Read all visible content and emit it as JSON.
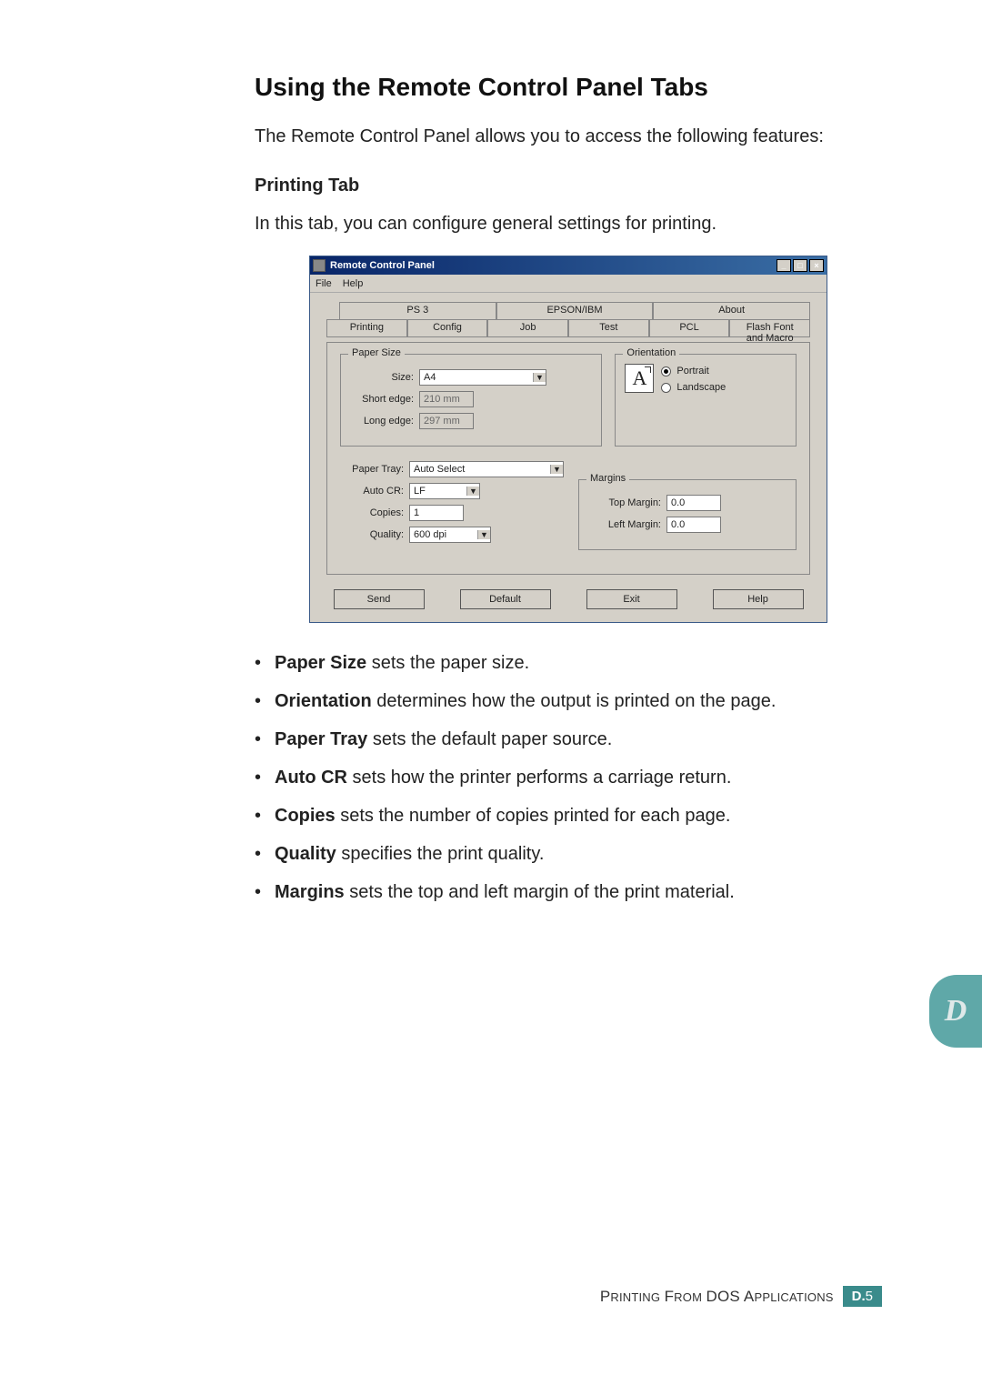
{
  "heading": "Using the Remote Control Panel Tabs",
  "intro": "The Remote Control Panel allows you to access the following features:",
  "subheading": "Printing Tab",
  "subintro": "In this tab, you can configure general settings for printing.",
  "window": {
    "title": "Remote Control Panel",
    "menu": {
      "file": "File",
      "help": "Help"
    },
    "win_btns": {
      "min": "_",
      "restore": "□",
      "close": "×"
    },
    "tabs_back": {
      "ps3": "PS 3",
      "epson": "EPSON/IBM",
      "about": "About"
    },
    "tabs_front": {
      "printing": "Printing",
      "config": "Config",
      "job": "Job",
      "test": "Test",
      "pcl": "PCL",
      "flash": "Flash Font and Macro"
    },
    "paper_group": {
      "legend": "Paper Size",
      "size_label": "Size:",
      "size_value": "A4",
      "short_edge_label": "Short edge:",
      "short_edge_value": "210 mm",
      "long_edge_label": "Long edge:",
      "long_edge_value": "297 mm"
    },
    "orient_group": {
      "legend": "Orientation",
      "icon_glyph": "A",
      "portrait": "Portrait",
      "landscape": "Landscape"
    },
    "mid": {
      "paper_tray_label": "Paper Tray:",
      "paper_tray_value": "Auto Select",
      "auto_cr_label": "Auto CR:",
      "auto_cr_value": "LF",
      "copies_label": "Copies:",
      "copies_value": "1",
      "quality_label": "Quality:",
      "quality_value": "600 dpi"
    },
    "margins_group": {
      "legend": "Margins",
      "top_label": "Top Margin:",
      "top_value": "0.0",
      "left_label": "Left Margin:",
      "left_value": "0.0"
    },
    "buttons": {
      "send": "Send",
      "default": "Default",
      "exit": "Exit",
      "help": "Help"
    }
  },
  "bullets": [
    {
      "term": "Paper Size",
      "rest": " sets the paper size."
    },
    {
      "term": "Orientation",
      "rest": " determines how the output is printed on the page."
    },
    {
      "term": "Paper Tray",
      "rest": " sets the default paper source."
    },
    {
      "term": "Auto CR",
      "rest": " sets how the printer performs a carriage return."
    },
    {
      "term": "Copies",
      "rest": " sets the number of copies printed for each page."
    },
    {
      "term": "Quality",
      "rest": " specifies the print quality."
    },
    {
      "term": "Margins",
      "rest": " sets the top and left margin of the print material."
    }
  ],
  "side_tab": "D",
  "footer": {
    "text_small1": "P",
    "text_rest1": "RINTING",
    "text_small2": "F",
    "text_rest2": "ROM",
    "text_small3": "DOS A",
    "text_rest3": "PPLICATIONS",
    "page_prefix": "D.",
    "page_num": "5"
  }
}
